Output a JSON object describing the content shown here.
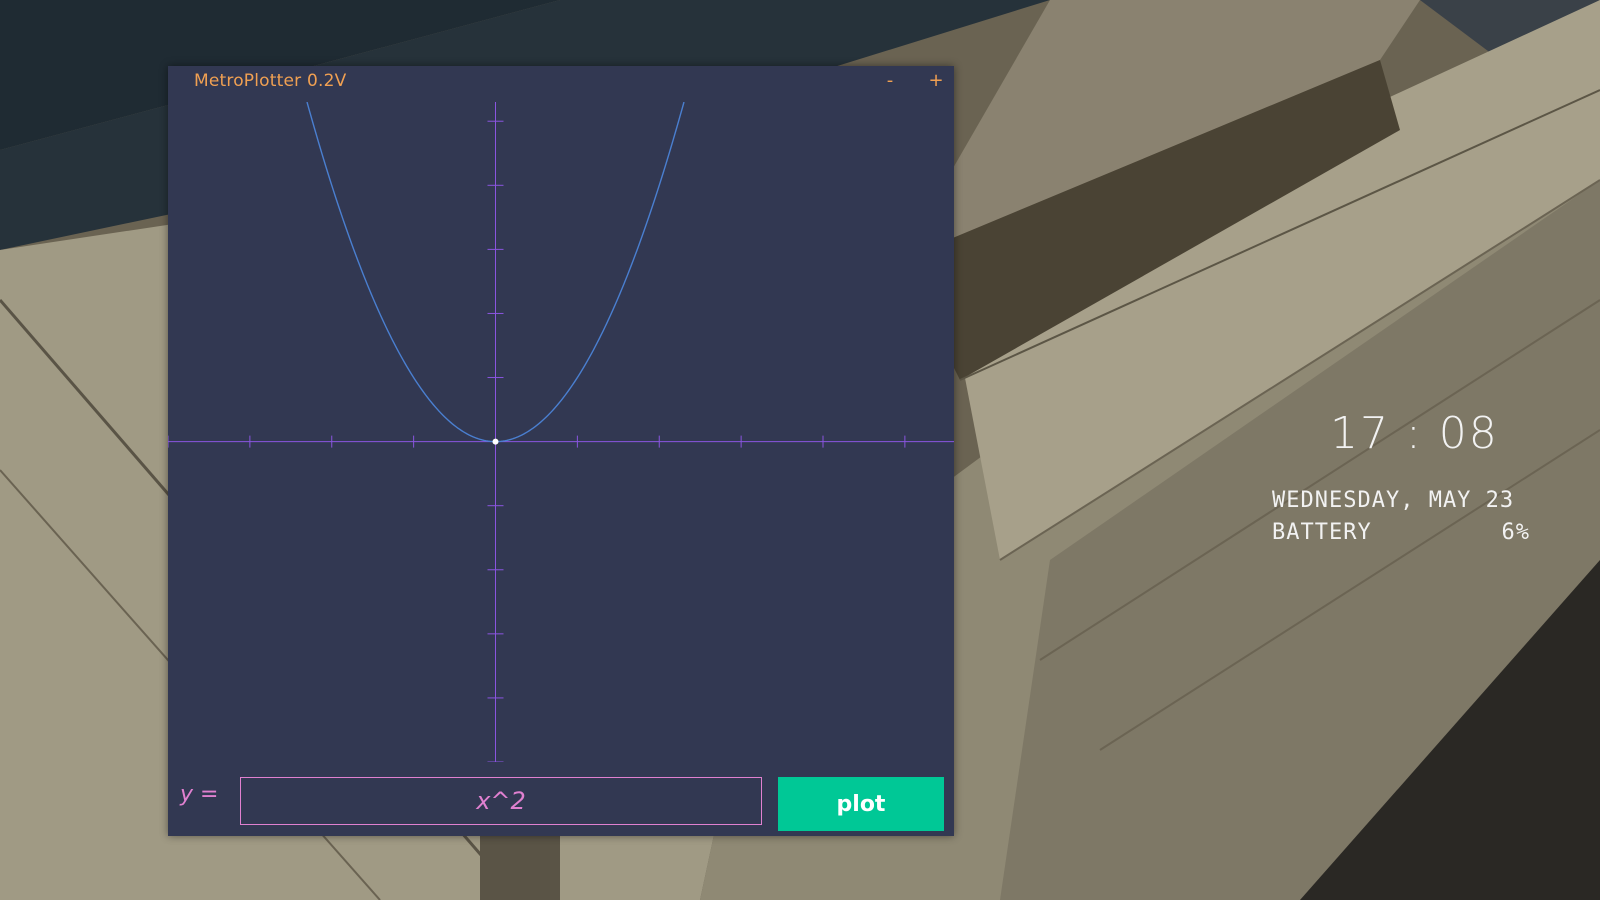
{
  "window": {
    "title": "MetroPlotter 0.2V",
    "minimize_label": "-",
    "maximize_label": "+"
  },
  "plot": {
    "expression_label": "y =",
    "expression": "x^2",
    "button_label": "plot",
    "x_range": [
      -4,
      5.6
    ],
    "y_range": [
      -5,
      5.3
    ],
    "tick_step": 1,
    "colors": {
      "background": "#323852",
      "axes": "#8a55e0",
      "curve": "#4a7fd0",
      "origin_point": "#ffffff",
      "title": "#f0a052",
      "input": "#e080d0",
      "button": "#00c896"
    }
  },
  "widget": {
    "time": "17 : 08",
    "date": "WEDNESDAY, MAY 23",
    "battery_label": "BATTERY",
    "battery_value": "6%"
  }
}
